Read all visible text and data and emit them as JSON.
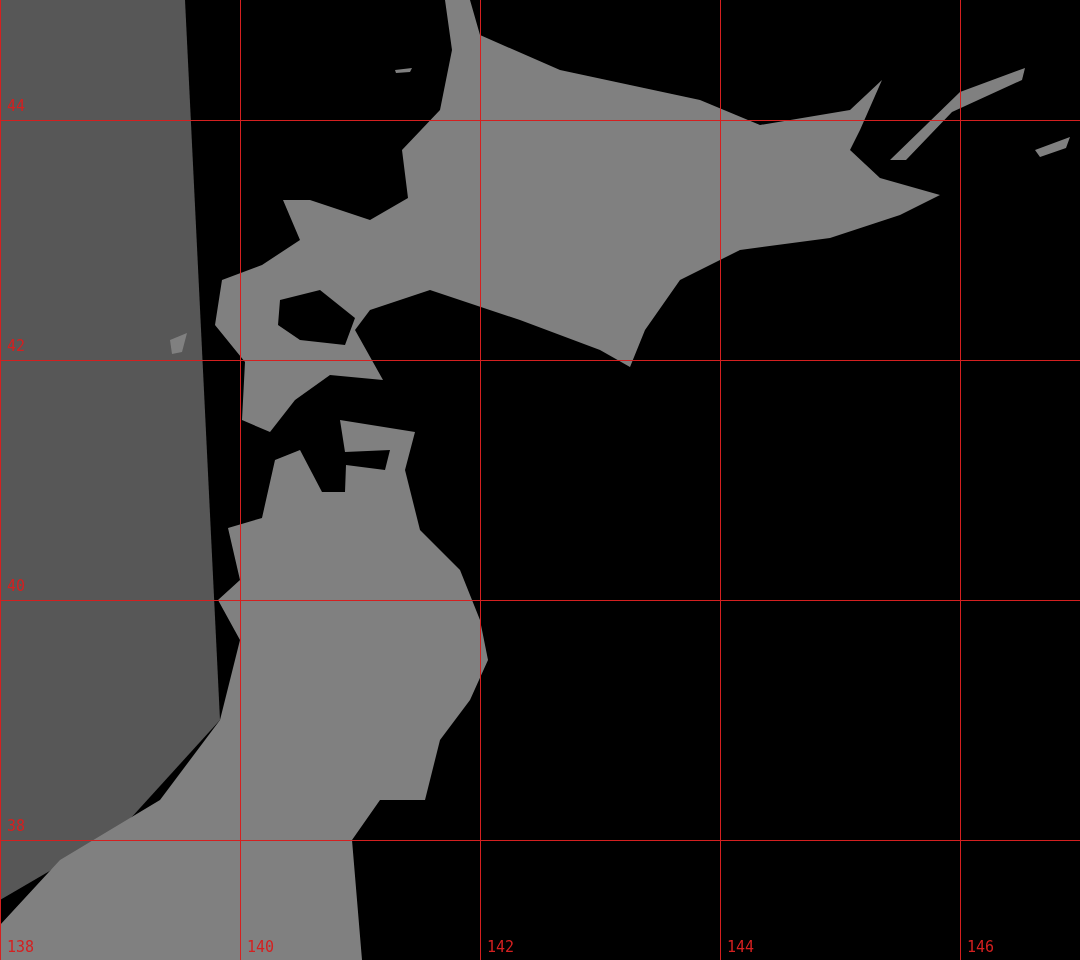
{
  "latitude_labels": [
    "44",
    "42",
    "40",
    "38"
  ],
  "longitude_labels": [
    "138",
    "140",
    "142",
    "144",
    "146"
  ]
}
